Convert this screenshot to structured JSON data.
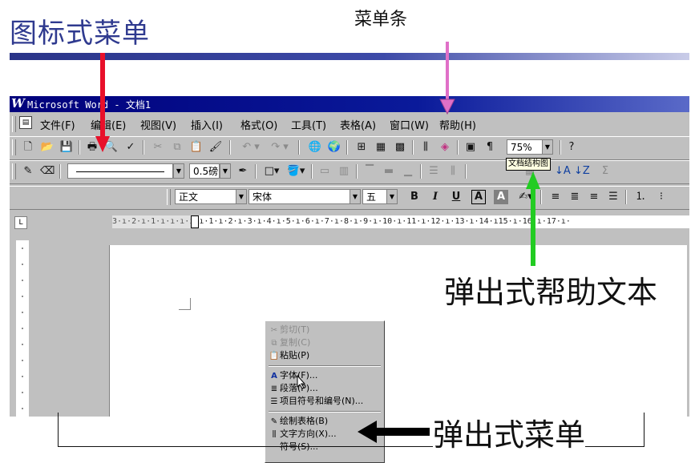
{
  "slide": {
    "title": "图标式菜单",
    "menubar_label": "菜单条",
    "popup_help_label": "弹出式帮助文本",
    "popup_menu_label": "弹出式菜单"
  },
  "colors": {
    "title": "#2f3a8f",
    "arrow_red": "#e8102a",
    "arrow_pink": "#e070c8",
    "arrow_green": "#22cc22"
  },
  "window": {
    "app_icon": "W",
    "title": "Microsoft Word - 文档1"
  },
  "menu": {
    "items": [
      "文件(F)",
      "编辑(E)",
      "视图(V)",
      "插入(I)",
      "格式(O)",
      "工具(T)",
      "表格(A)",
      "窗口(W)",
      "帮助(H)"
    ]
  },
  "standard_toolbar": {
    "zoom": "75%"
  },
  "drawing_toolbar": {
    "line_weight": "0.5磅"
  },
  "format_toolbar": {
    "style": "正文",
    "font": "宋体",
    "size": "五",
    "bold": "B",
    "italic": "I",
    "underline": "U",
    "box": "A",
    "shade": "A"
  },
  "tooltip": "文档结构图",
  "ruler_text": "3·ı·2·ı·1·ı·ı·ı·ı·ı·1·ı·2·ı·3·ı·4·ı·5·ı·6·ı·7·ı·8·ı·9·ı·10·ı·11·ı·12·ı·13·ı·14·ı15·ı·16·ı·17·ı·",
  "context_menu": {
    "items": [
      {
        "label": "剪切(T)",
        "enabled": false,
        "icon": "scissors-icon"
      },
      {
        "label": "复制(C)",
        "enabled": false,
        "icon": "copy-icon"
      },
      {
        "label": "粘贴(P)",
        "enabled": true,
        "icon": "paste-icon"
      },
      {
        "label": "字体(F)...",
        "enabled": true,
        "icon": "font-icon"
      },
      {
        "label": "段落(P)...",
        "enabled": true,
        "icon": "paragraph-icon"
      },
      {
        "label": "项目符号和编号(N)...",
        "enabled": true,
        "icon": "bullets-icon"
      },
      {
        "label": "绘制表格(B)",
        "enabled": true,
        "icon": "pencil-icon"
      },
      {
        "label": "文字方向(X)...",
        "enabled": true,
        "icon": "text-direction-icon"
      },
      {
        "label": "符号(S)...",
        "enabled": true,
        "icon": ""
      }
    ]
  }
}
